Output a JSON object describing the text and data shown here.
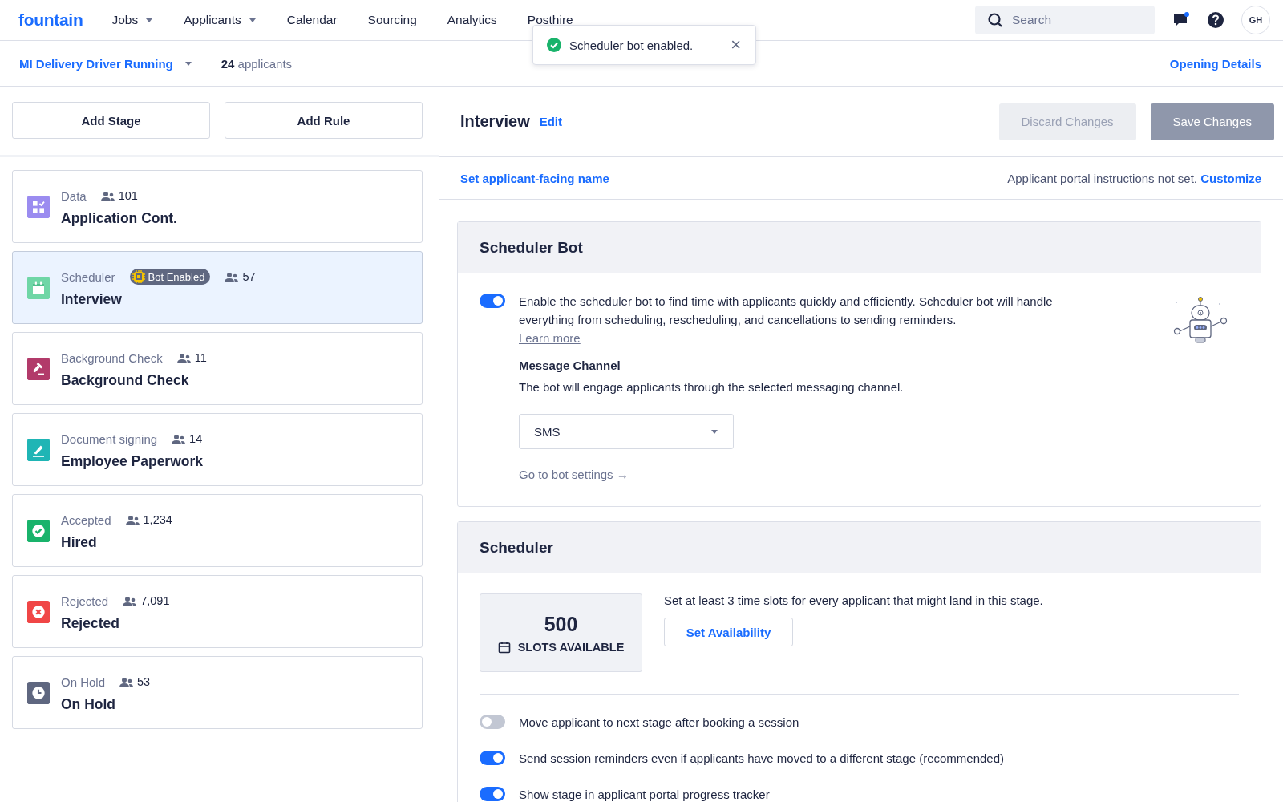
{
  "nav": {
    "logo": "fountain",
    "items": [
      {
        "label": "Jobs",
        "dropdown": true
      },
      {
        "label": "Applicants",
        "dropdown": true
      },
      {
        "label": "Calendar",
        "dropdown": false
      },
      {
        "label": "Sourcing",
        "dropdown": false
      },
      {
        "label": "Analytics",
        "dropdown": false
      },
      {
        "label": "Posthire",
        "dropdown": false
      }
    ],
    "search": {
      "placeholder": "Search"
    },
    "messages_unread": true,
    "avatar": "GH"
  },
  "toast": {
    "message": "Scheduler bot enabled.",
    "close": "×"
  },
  "opening": {
    "title": "MI Delivery Driver Running",
    "count": "24",
    "count_label": "applicants",
    "details_link": "Opening Details"
  },
  "sidebar": {
    "buttons": [
      "Add Stage",
      "Add Rule"
    ],
    "stages": [
      {
        "kind": "data",
        "color": "#9b8cf0",
        "type": "Data",
        "count": "101",
        "name": "Application Cont.",
        "selected": false
      },
      {
        "kind": "scheduler",
        "color": "#6fd6a6",
        "type": "Scheduler",
        "badge": "Bot Enabled",
        "count": "57",
        "name": "Interview",
        "selected": true
      },
      {
        "kind": "background",
        "color": "#b23a6a",
        "type": "Background Check",
        "count": "11",
        "name": "Background Check",
        "selected": false
      },
      {
        "kind": "document",
        "color": "#1fb5b5",
        "type": "Document signing",
        "count": "14",
        "name": "Employee Paperwork",
        "selected": false
      },
      {
        "kind": "accepted",
        "color": "#19b36b",
        "type": "Accepted",
        "count": "1,234",
        "name": "Hired",
        "selected": false
      },
      {
        "kind": "rejected",
        "color": "#f04646",
        "type": "Rejected",
        "count": "7,091",
        "name": "Rejected",
        "selected": false
      },
      {
        "kind": "hold",
        "color": "#5f6780",
        "type": "On Hold",
        "count": "53",
        "name": "On Hold",
        "selected": false
      }
    ]
  },
  "stage_header": {
    "title": "Interview",
    "edit": "Edit",
    "buttons": [
      {
        "label": "Discard Changes",
        "kind": "secondary",
        "disabled": true
      },
      {
        "label": "Save Changes",
        "kind": "primary",
        "disabled": true
      }
    ]
  },
  "name_row": {
    "link": "Set applicant-facing name",
    "note": "Applicant portal instructions not set.",
    "customize": "Customize"
  },
  "scheduler_bot": {
    "title": "Scheduler Bot",
    "enabled": true,
    "description": "Enable the scheduler bot to find time with applicants quickly and efficiently. Scheduler bot will handle everything from scheduling, rescheduling, and cancellations to sending reminders.",
    "learn_more": "Learn more",
    "channel_label": "Message Channel",
    "channel_help": "The bot will engage applicants through the selected messaging channel.",
    "channel_value": "SMS",
    "settings_link": "Go to bot settings →"
  },
  "scheduler": {
    "title": "Scheduler",
    "slots": "500",
    "slots_label": "SLOTS AVAILABLE",
    "help": "Set at least 3 time slots for every applicant that might land in this stage.",
    "availability_button": "Set Availability",
    "options": [
      {
        "label": "Move applicant to next stage after booking a session",
        "on": false
      },
      {
        "label": "Send session reminders even if applicants have moved to a different stage (recommended)",
        "on": true
      },
      {
        "label": "Show stage in applicant portal progress tracker",
        "on": true
      }
    ]
  }
}
